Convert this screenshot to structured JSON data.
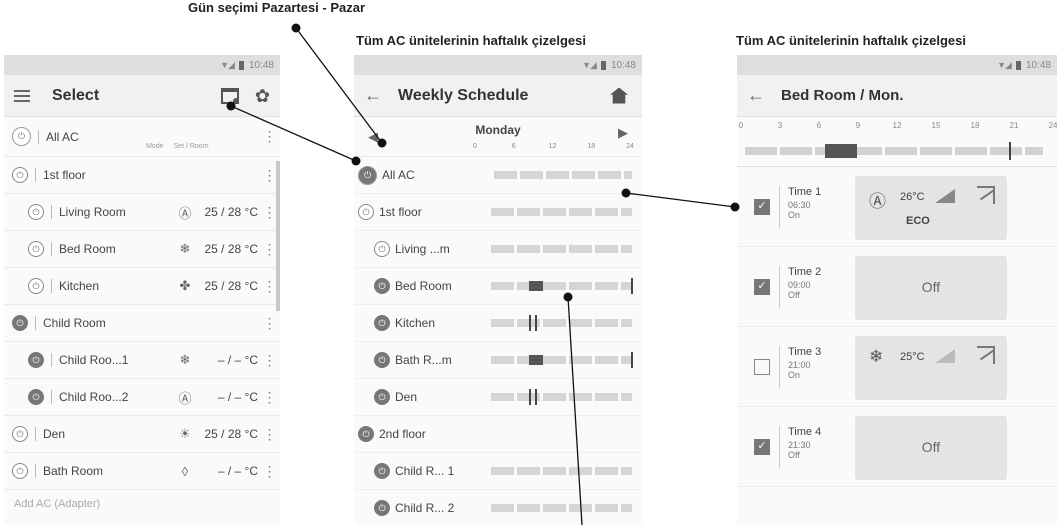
{
  "callouts": {
    "day_selection": "Gün seçimi Pazartesi - Pazar",
    "weekly_schedule_1": "Tüm AC ünitelerinin haftalık çizelgesi",
    "weekly_schedule_2": "Tüm AC ünitelerinin haftalık çizelgesi"
  },
  "status_time": "10:48",
  "select_screen": {
    "title": "Select",
    "col_mode": "Mode",
    "col_set_room": "Set / Room",
    "rows": [
      {
        "label": "All AC",
        "mode": "",
        "temp": ""
      },
      {
        "label": "1st floor",
        "mode": "",
        "temp": ""
      },
      {
        "label": "Living Room",
        "mode": "Ⓐ",
        "temp": "25 / 28 °C"
      },
      {
        "label": "Bed Room",
        "mode": "❄",
        "temp": "25 / 28 °C"
      },
      {
        "label": "Kitchen",
        "mode": "✤",
        "temp": "25 / 28 °C"
      },
      {
        "label": "Child Room",
        "mode": "",
        "temp": ""
      },
      {
        "label": "Child Roo...1",
        "mode": "❄",
        "temp": "– / –  °C"
      },
      {
        "label": "Child Roo...2",
        "mode": "Ⓐ",
        "temp": "– / –  °C"
      },
      {
        "label": "Den",
        "mode": "☀",
        "temp": "25 / 28 °C"
      },
      {
        "label": "Bath Room",
        "mode": "💧",
        "temp": "– / –  °C"
      }
    ],
    "add_ac": "Add AC (Adapter)"
  },
  "weekly_screen": {
    "title": "Weekly Schedule",
    "day": "Monday",
    "ticks": [
      "0",
      "6",
      "12",
      "18",
      "24"
    ],
    "rows": [
      {
        "label": "All AC",
        "power_on": true
      },
      {
        "label": "1st floor",
        "power_on": false
      },
      {
        "label": "Living ...m",
        "power_on": false
      },
      {
        "label": "Bed Room",
        "power_on": true
      },
      {
        "label": "Kitchen",
        "power_on": true
      },
      {
        "label": "Bath R...m",
        "power_on": true
      },
      {
        "label": "Den",
        "power_on": true
      },
      {
        "label": "2nd floor",
        "power_on": true
      },
      {
        "label": "Child R... 1",
        "power_on": true
      },
      {
        "label": "Child R... 2",
        "power_on": true
      }
    ]
  },
  "day_screen": {
    "title": "Bed Room / Mon.",
    "ticks": [
      "0",
      "3",
      "6",
      "9",
      "12",
      "15",
      "18",
      "21",
      "24"
    ],
    "timers": [
      {
        "name": "Time 1",
        "time": "06:30",
        "state": "On",
        "checked": true,
        "card": {
          "kind": "setting",
          "temp": "26°C",
          "extra": "ECO"
        }
      },
      {
        "name": "Time 2",
        "time": "09:00",
        "state": "Off",
        "checked": true,
        "card": {
          "kind": "off",
          "label": "Off"
        }
      },
      {
        "name": "Time 3",
        "time": "21:00",
        "state": "On",
        "checked": false,
        "card": {
          "kind": "setting",
          "temp": "25°C",
          "extra": ""
        }
      },
      {
        "name": "Time 4",
        "time": "21:30",
        "state": "Off",
        "checked": true,
        "card": {
          "kind": "off",
          "label": "Off"
        }
      }
    ]
  }
}
